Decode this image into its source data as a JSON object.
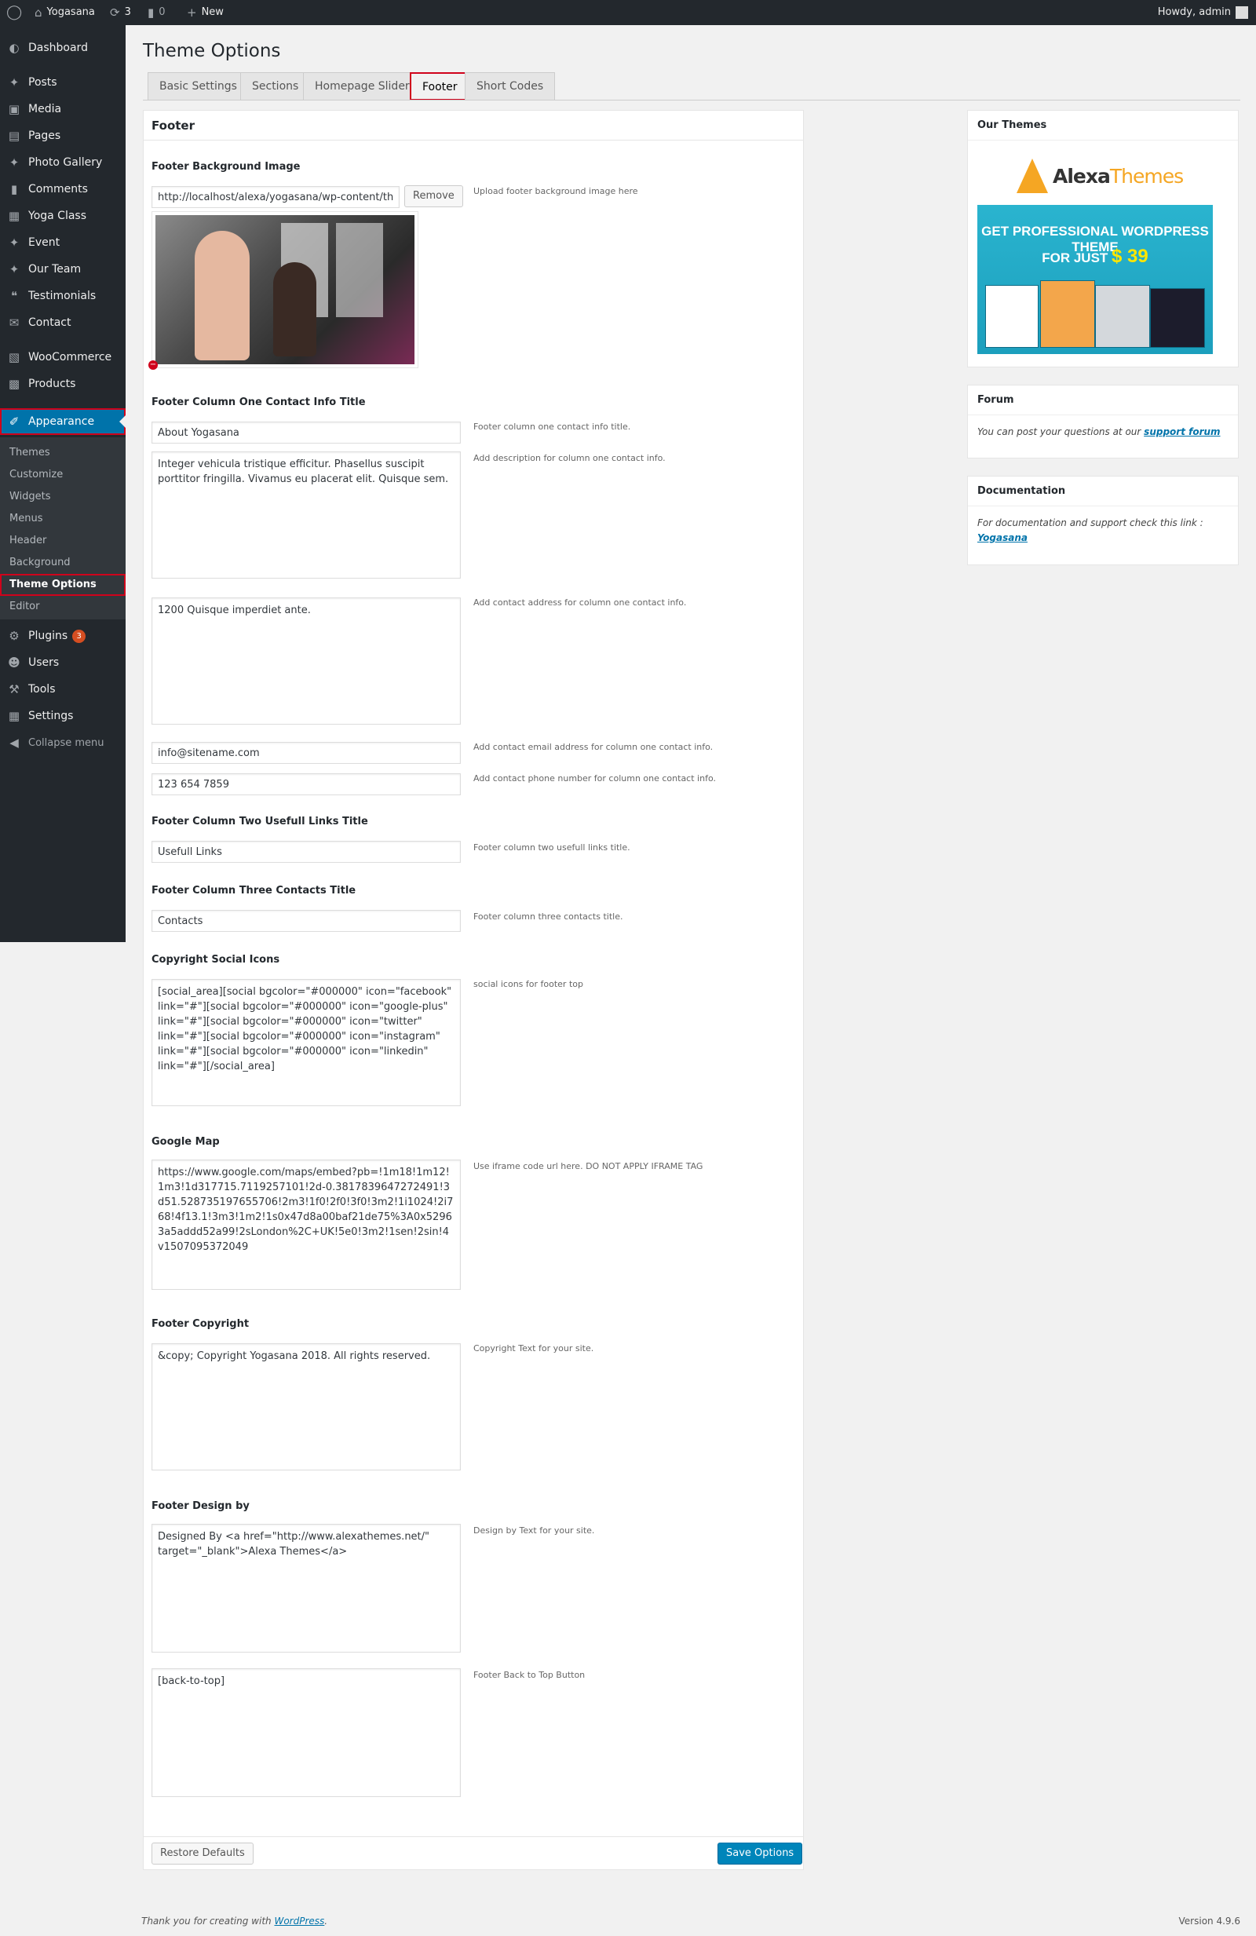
{
  "admin_bar": {
    "site_name": "Yogasana",
    "updates_count": "3",
    "comments_count": "0",
    "new_label": "New",
    "howdy": "Howdy, admin"
  },
  "sidebar": {
    "dashboard": "Dashboard",
    "posts": "Posts",
    "media": "Media",
    "pages": "Pages",
    "photo_gallery": "Photo Gallery",
    "comments": "Comments",
    "yoga_class": "Yoga Class",
    "event": "Event",
    "our_team": "Our Team",
    "testimonials": "Testimonials",
    "contact": "Contact",
    "woocommerce": "WooCommerce",
    "products": "Products",
    "appearance": "Appearance",
    "submenu": {
      "themes": "Themes",
      "customize": "Customize",
      "widgets": "Widgets",
      "menus": "Menus",
      "header": "Header",
      "background": "Background",
      "theme_options": "Theme Options",
      "editor": "Editor"
    },
    "plugins": "Plugins",
    "plugins_badge": "3",
    "users": "Users",
    "tools": "Tools",
    "settings": "Settings",
    "collapse": "Collapse menu"
  },
  "page": {
    "title": "Theme Options",
    "tabs": {
      "basic": "Basic Settings",
      "sections": "Sections",
      "slider": "Homepage Slider",
      "footer": "Footer",
      "shortcodes": "Short Codes"
    }
  },
  "panel": {
    "heading": "Footer",
    "bg_image": {
      "label": "Footer Background Image",
      "value": "http://localhost/alexa/yogasana/wp-content/themes/",
      "remove": "Remove",
      "desc": "Upload footer background image here"
    },
    "col1": {
      "label": "Footer Column One Contact Info Title",
      "title_value": "About Yogasana",
      "title_desc": "Footer column one contact info title.",
      "desc_value": "Integer vehicula tristique efficitur. Phasellus suscipit porttitor fringilla. Vivamus eu placerat elit. Quisque sem.",
      "desc_desc": "Add description for column one contact info.",
      "address_value": "1200 Quisque imperdiet ante.",
      "address_desc": "Add contact address for column one contact info.",
      "email_value": "info@sitename.com",
      "email_desc": "Add contact email address for column one contact info.",
      "phone_value": "123 654 7859",
      "phone_desc": "Add contact phone number for column one contact info."
    },
    "col2": {
      "label": "Footer Column Two Usefull Links Title",
      "value": "Usefull Links",
      "desc": "Footer column two usefull links title."
    },
    "col3": {
      "label": "Footer Column Three Contacts Title",
      "value": "Contacts",
      "desc": "Footer column three contacts title."
    },
    "social": {
      "label": "Copyright Social Icons",
      "value": "[social_area][social bgcolor=\"#000000\" icon=\"facebook\" link=\"#\"][social bgcolor=\"#000000\" icon=\"google-plus\" link=\"#\"][social bgcolor=\"#000000\" icon=\"twitter\" link=\"#\"][social bgcolor=\"#000000\" icon=\"instagram\" link=\"#\"][social bgcolor=\"#000000\" icon=\"linkedin\" link=\"#\"][/social_area]",
      "desc": "social icons for footer top"
    },
    "map": {
      "label": "Google Map",
      "value": "https://www.google.com/maps/embed?pb=!1m18!1m12!1m3!1d317715.7119257101!2d-0.3817839647272491!3d51.528735197655706!2m3!1f0!2f0!3f0!3m2!1i1024!2i768!4f13.1!3m3!1m2!1s0x47d8a00baf21de75%3A0x52963a5addd52a99!2sLondon%2C+UK!5e0!3m2!1sen!2sin!4v1507095372049",
      "desc": "Use iframe code url here. DO NOT APPLY IFRAME TAG"
    },
    "copyright": {
      "label": "Footer Copyright",
      "value": "&copy; Copyright Yogasana 2018. All rights reserved.",
      "desc": "Copyright Text for your site."
    },
    "design_by": {
      "label": "Footer Design by",
      "value": "Designed By <a href=\"http://www.alexathemes.net/\" target=\"_blank\">Alexa Themes</a>",
      "desc": "Design by Text for your site."
    },
    "back_to_top": {
      "value": "[back-to-top]",
      "desc": "Footer Back to Top Button"
    },
    "restore": "Restore Defaults",
    "save": "Save Options"
  },
  "side_boxes": {
    "themes": {
      "title": "Our Themes",
      "logo_a": "Alexa",
      "logo_b": "Themes",
      "line1": "GET PROFESSIONAL WORDPRESS THEME",
      "line2": "FOR JUST",
      "price": "$ 39"
    },
    "forum": {
      "title": "Forum",
      "text": "You can post your questions at our",
      "link": "support forum"
    },
    "docs": {
      "title": "Documentation",
      "text": "For documentation and support check this link :",
      "link": "Yogasana"
    }
  },
  "footer": {
    "thanks": "Thank you for creating with",
    "wp_link": "WordPress",
    "version": "Version 4.9.6"
  },
  "colors": {
    "admin_dark": "#23282d",
    "accent_blue": "#0073aa",
    "highlight_red": "#d0021b"
  }
}
